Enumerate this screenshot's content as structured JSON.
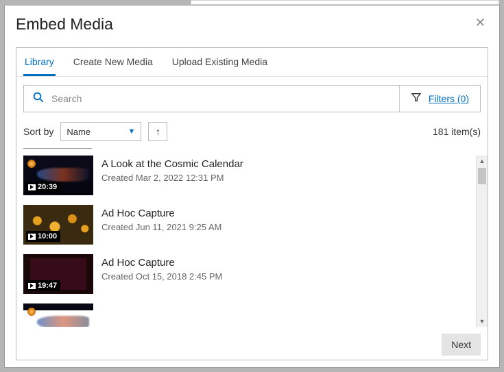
{
  "header": {
    "title": "Embed Media",
    "close_label": "✕"
  },
  "tabs": [
    {
      "label": "Library",
      "active": true
    },
    {
      "label": "Create New Media",
      "active": false
    },
    {
      "label": "Upload Existing Media",
      "active": false
    }
  ],
  "search": {
    "placeholder": "Search",
    "filters_label": "Filters (0)"
  },
  "sort": {
    "label": "Sort by",
    "selected": "Name",
    "direction_glyph": "↑"
  },
  "count_text": "181 item(s)",
  "items": [
    {
      "title": "A Look at the Cosmic Calendar",
      "created": "Created Mar 2, 2022 12:31 PM",
      "duration": "20:39",
      "thumb_class": "cosmic"
    },
    {
      "title": "Ad Hoc Capture",
      "created": "Created Jun 11, 2021 9:25 AM",
      "duration": "10:00",
      "thumb_class": "flowers"
    },
    {
      "title": "Ad Hoc Capture",
      "created": "Created Oct 15, 2018 2:45 PM",
      "duration": "19:47",
      "thumb_class": "dark"
    }
  ],
  "footer": {
    "next_label": "Next"
  }
}
